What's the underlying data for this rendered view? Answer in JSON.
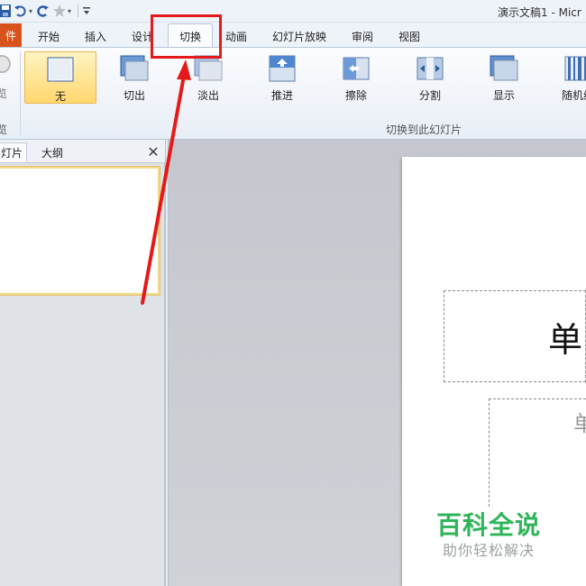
{
  "window": {
    "title": "演示文稿1 - Micr"
  },
  "qat": {
    "more": "▾"
  },
  "tabs": {
    "file": "件",
    "home": "开始",
    "insert": "插入",
    "design": "设计",
    "transitions": "切换",
    "animations": "动画",
    "slideshow": "幻灯片放映",
    "review": "审阅",
    "view": "视图"
  },
  "ribbon": {
    "preview_label": "览",
    "preview_group": "览",
    "group_label": "切换到此幻灯片",
    "items": [
      {
        "label": "无"
      },
      {
        "label": "切出"
      },
      {
        "label": "淡出"
      },
      {
        "label": "推进"
      },
      {
        "label": "擦除"
      },
      {
        "label": "分割"
      },
      {
        "label": "显示"
      },
      {
        "label": "随机线"
      }
    ]
  },
  "left_pane": {
    "tab_slides": "灯片",
    "tab_outline": "大纲",
    "close": "✕"
  },
  "slide": {
    "title_text": "单",
    "subtitle_text": "单"
  },
  "watermark": {
    "main": "百科全说",
    "sub": "助你轻松解决"
  },
  "colors": {
    "annotation": "#e41a1a",
    "file_tab": "#d9531c",
    "selected_item": "#ffd76e",
    "watermark": "#2fb45a"
  }
}
